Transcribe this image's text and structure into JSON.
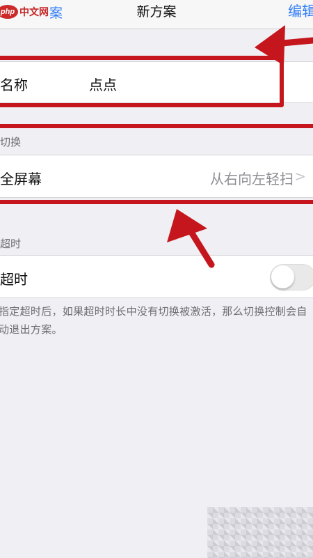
{
  "navbar": {
    "logo_text": "php",
    "site_text": "中文网",
    "back_label": "案",
    "title": "新方案",
    "edit_label": "编辑"
  },
  "name_row": {
    "label": "名称",
    "value": "点点"
  },
  "switch_section": {
    "header": "切换",
    "row_label": "全屏幕",
    "row_value": "从右向左轻扫",
    "chevron": ">"
  },
  "timeout_section": {
    "header": "超时",
    "row_label": "超时",
    "toggle_on": false
  },
  "footnote": "指定超时后，如果超时时长中没有切换被激活，那么切换控制会自动退出方案。",
  "colors": {
    "highlight": "#c4161c",
    "accent": "#2f7cf6",
    "background": "#efeff4"
  }
}
